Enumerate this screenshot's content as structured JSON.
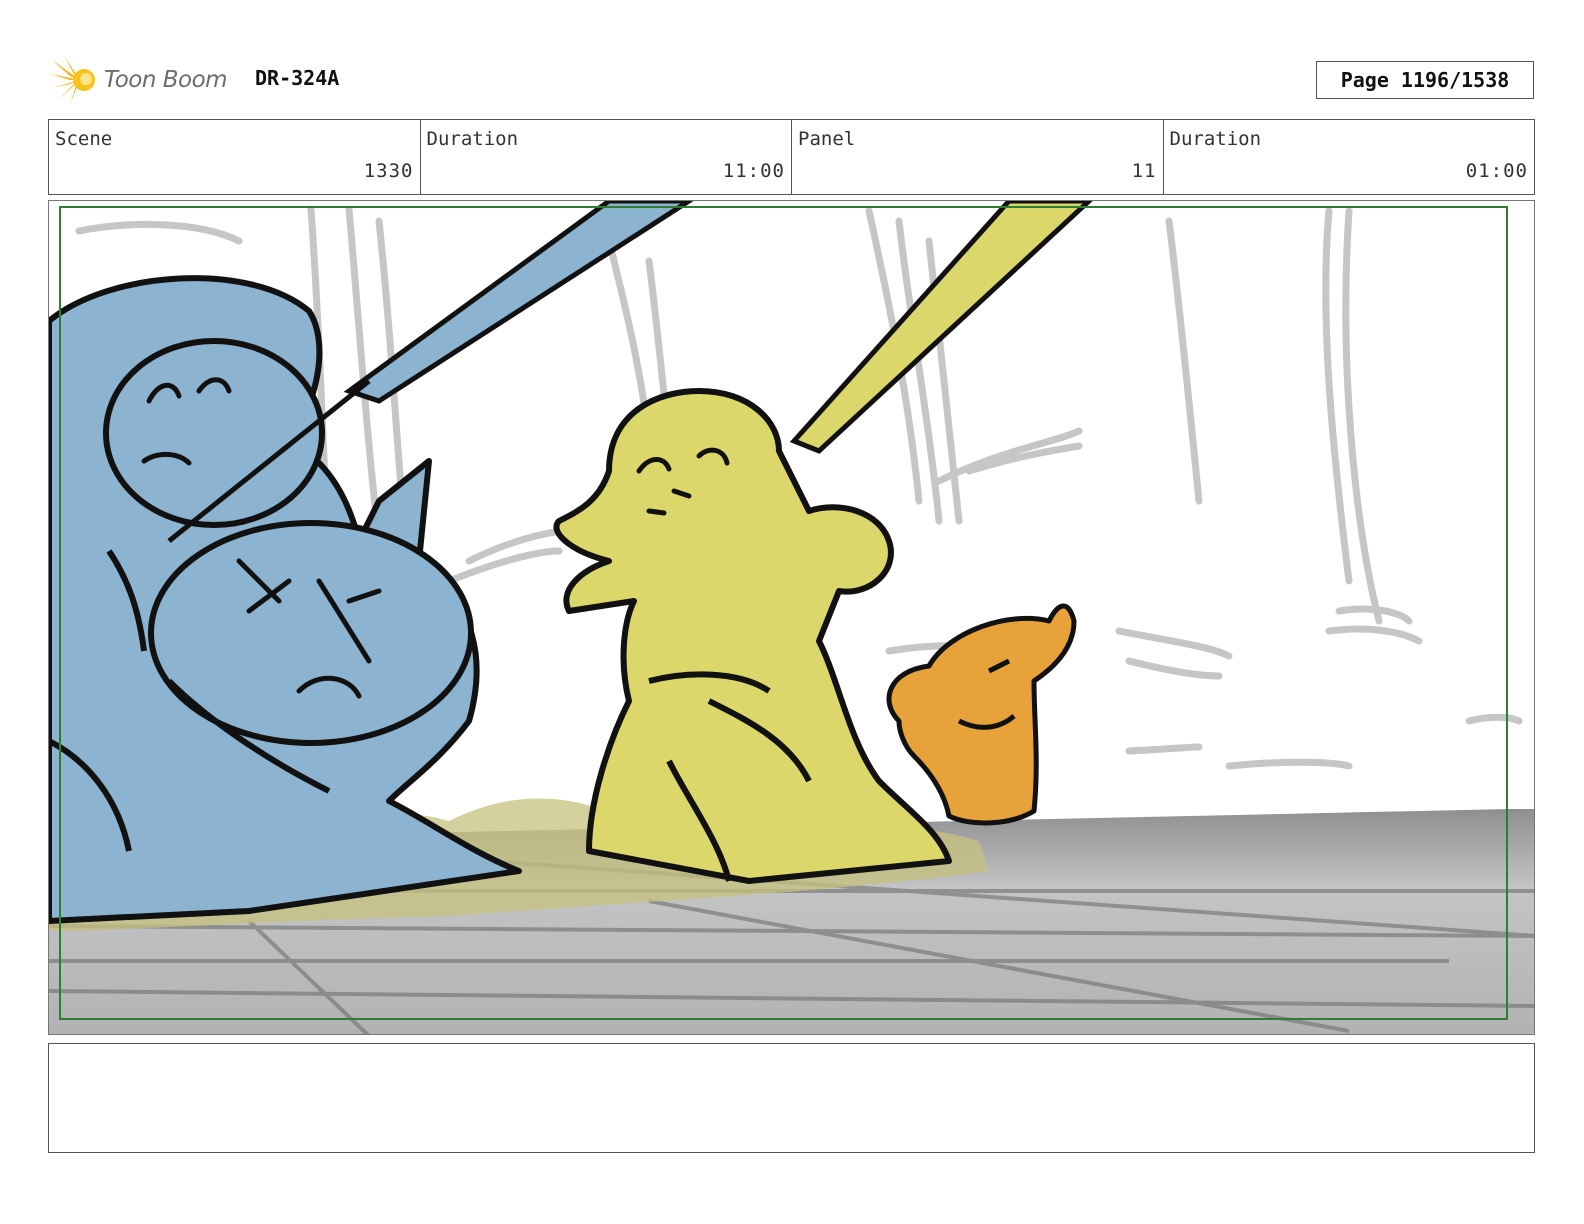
{
  "header": {
    "logo_text": "Toon Boom",
    "project_code": "DR-324A",
    "page_label": "Page 1196/1538"
  },
  "info": [
    {
      "label": "Scene",
      "value": "1330"
    },
    {
      "label": "Duration",
      "value": "11:00"
    },
    {
      "label": "Panel",
      "value": "11"
    },
    {
      "label": "Duration",
      "value": "01:00"
    }
  ],
  "colors": {
    "safe_frame": "#2e7d32",
    "blue_character": "#8cb3cf",
    "yellow_character": "#dcd76a",
    "orange_character": "#e8a23a",
    "floor": "#b7b7b9"
  },
  "notes": ""
}
